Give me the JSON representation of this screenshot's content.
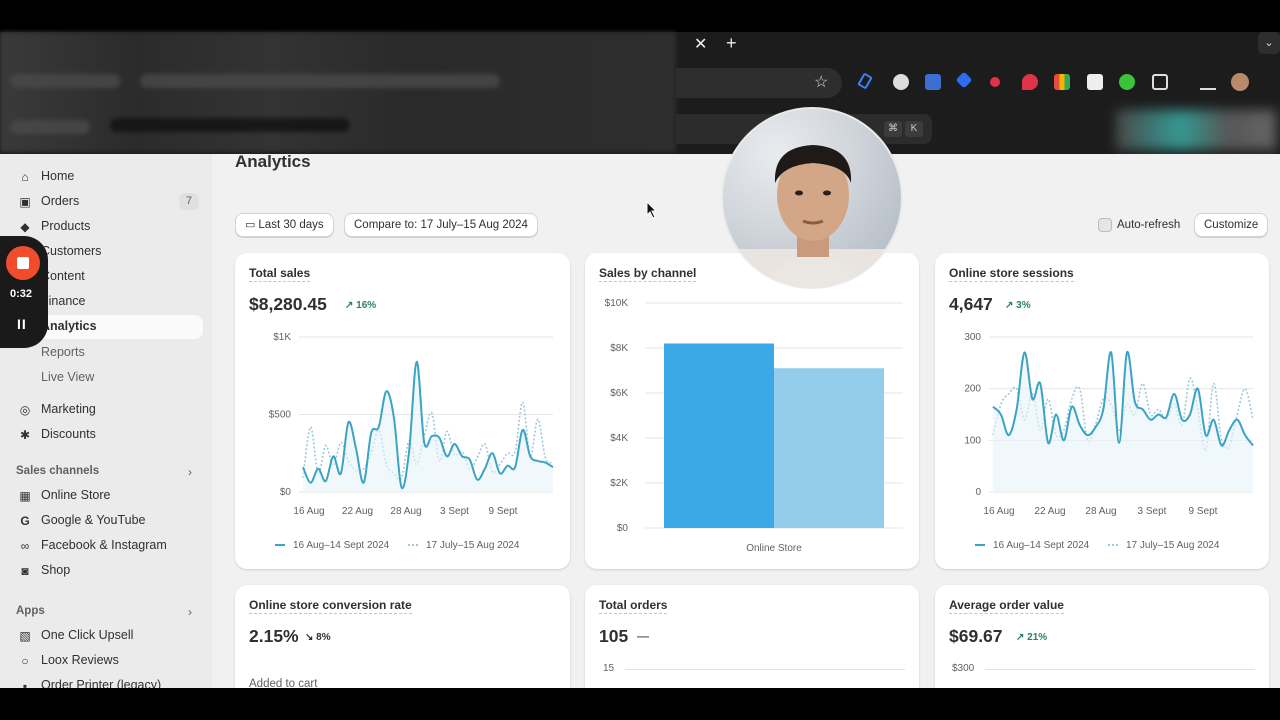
{
  "browser": {
    "tab_close": "✕",
    "new_tab": "+",
    "search_shortcut_keys": [
      "⌘",
      "K"
    ]
  },
  "sidebar": {
    "items": [
      {
        "label": "Home",
        "icon": "home-icon"
      },
      {
        "label": "Orders",
        "icon": "inbox-icon",
        "badge": "7"
      },
      {
        "label": "Products",
        "icon": "tag-icon"
      },
      {
        "label": "Customers",
        "icon": "person-icon"
      },
      {
        "label": "Content",
        "icon": "content-icon"
      },
      {
        "label": "Finance",
        "icon": "bank-icon"
      },
      {
        "label": "Analytics",
        "icon": "chart-icon",
        "active": true
      },
      {
        "label": "Reports"
      },
      {
        "label": "Live View"
      },
      {
        "label": "Marketing",
        "icon": "target-icon"
      },
      {
        "label": "Discounts",
        "icon": "discount-icon"
      }
    ],
    "sales_channels_title": "Sales channels",
    "sales_channels": [
      {
        "label": "Online Store",
        "icon": "store-icon"
      },
      {
        "label": "Google & YouTube",
        "icon": "google-icon"
      },
      {
        "label": "Facebook & Instagram",
        "icon": "meta-icon"
      },
      {
        "label": "Shop",
        "icon": "shop-icon"
      }
    ],
    "apps_title": "Apps",
    "apps": [
      {
        "label": "One Click Upsell",
        "icon": "upsell-icon"
      },
      {
        "label": "Loox Reviews",
        "icon": "loox-icon"
      },
      {
        "label": "Order Printer (legacy)",
        "icon": "printer-icon"
      }
    ]
  },
  "recorder": {
    "time": "0:32",
    "pause": "II"
  },
  "main": {
    "title": "Analytics",
    "date_range": "Last 30 days",
    "compare": "Compare to: 17 July–15 Aug 2024",
    "auto_refresh": "Auto-refresh",
    "customize": "Customize"
  },
  "cards": {
    "total_sales": {
      "title": "Total sales",
      "value": "$8,280.45",
      "trend": "↗ 16%"
    },
    "sales_by_channel": {
      "title": "Sales by channel"
    },
    "sessions": {
      "title": "Online store sessions",
      "value": "4,647",
      "trend": "↗ 3%"
    },
    "conversion": {
      "title": "Online store conversion rate",
      "value": "2.15%",
      "trend": "↘ 8%",
      "sub": "Added to cart"
    },
    "total_orders": {
      "title": "Total orders",
      "value": "105",
      "trend": "—",
      "first_tick": "15"
    },
    "aov": {
      "title": "Average order value",
      "value": "$69.67",
      "trend": "↗ 21%",
      "first_tick": "$300"
    }
  },
  "chart_data": [
    {
      "type": "line",
      "title": "Total sales",
      "x_ticks": [
        "16 Aug",
        "22 Aug",
        "28 Aug",
        "3 Sept",
        "9 Sept"
      ],
      "y_ticks": [
        "$0",
        "$500",
        "$1K"
      ],
      "ylim": [
        0,
        1000
      ],
      "series": [
        {
          "name": "16 Aug–14 Sept 2024",
          "style": "solid",
          "color": "#3ba3c4",
          "values": [
            160,
            60,
            150,
            70,
            230,
            120,
            450,
            280,
            60,
            380,
            420,
            650,
            480,
            30,
            260,
            840,
            320,
            360,
            350,
            230,
            310,
            230,
            210,
            80,
            150,
            250,
            120,
            170,
            160,
            400,
            230,
            200,
            190,
            160
          ]
        },
        {
          "name": "17 July–15 Aug 2024",
          "style": "dotted",
          "color": "#9cc9dc",
          "values": [
            90,
            420,
            120,
            300,
            170,
            320,
            200,
            140,
            150,
            250,
            400,
            180,
            120,
            90,
            330,
            180,
            360,
            510,
            200,
            390,
            240,
            260,
            150,
            220,
            310,
            130,
            180,
            250,
            260,
            580,
            230,
            470,
            220,
            190
          ]
        }
      ]
    },
    {
      "type": "bar",
      "title": "Sales by channel",
      "categories": [
        "Online Store"
      ],
      "y_ticks": [
        "$0",
        "$2K",
        "$4K",
        "$6K",
        "$8K",
        "$10K"
      ],
      "ylim": [
        0,
        10000
      ],
      "series": [
        {
          "values": [
            8200
          ],
          "color": "#3aa9e6"
        },
        {
          "values": [
            7100
          ],
          "color": "#94cdec"
        }
      ]
    },
    {
      "type": "line",
      "title": "Online store sessions",
      "x_ticks": [
        "16 Aug",
        "22 Aug",
        "28 Aug",
        "3 Sept",
        "9 Sept"
      ],
      "y_ticks": [
        "0",
        "100",
        "200",
        "300"
      ],
      "ylim": [
        0,
        300
      ],
      "series": [
        {
          "name": "16 Aug–14 Sept 2024",
          "style": "solid",
          "color": "#3ba3c4",
          "values": [
            165,
            150,
            110,
            160,
            270,
            180,
            210,
            95,
            150,
            100,
            165,
            130,
            110,
            125,
            160,
            270,
            95,
            270,
            175,
            160,
            140,
            150,
            145,
            190,
            140,
            150,
            200,
            110,
            140,
            90,
            120,
            140,
            110,
            90
          ]
        },
        {
          "name": "17 July–15 Aug 2024",
          "style": "dotted",
          "color": "#9cc9dc",
          "values": [
            110,
            170,
            190,
            200,
            140,
            190,
            120,
            180,
            110,
            120,
            180,
            200,
            100,
            130,
            180,
            170,
            120,
            170,
            150,
            210,
            150,
            160,
            140,
            170,
            130,
            220,
            160,
            80,
            210,
            100,
            90,
            150,
            200,
            140
          ]
        }
      ]
    }
  ]
}
